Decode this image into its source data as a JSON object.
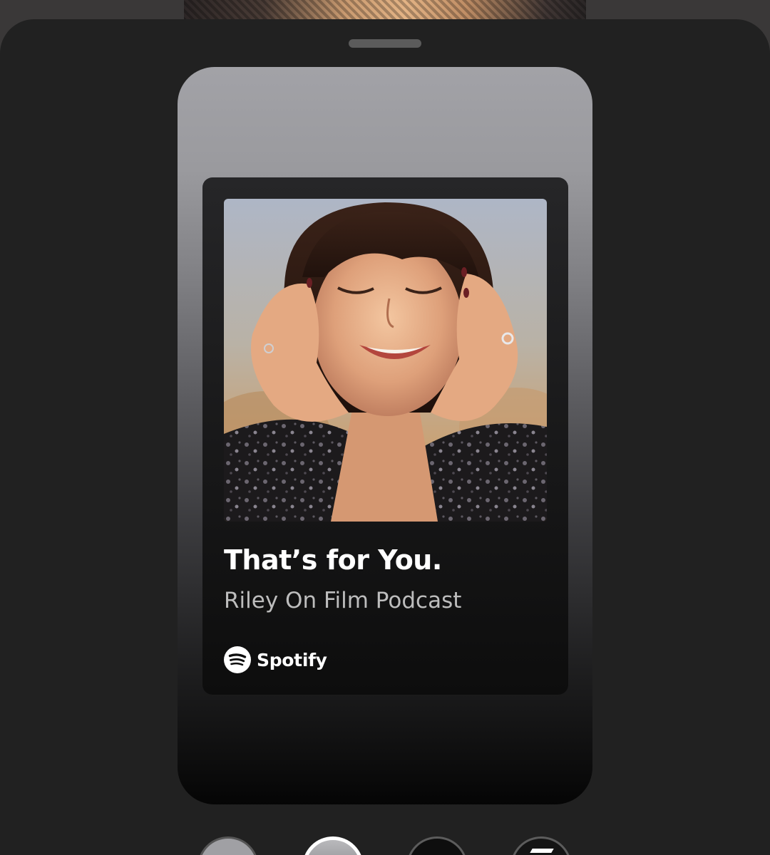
{
  "share_card": {
    "episode_title": "That’s for You.",
    "show_name": "Riley On Film Podcast",
    "brand_name": "Spotify"
  },
  "background_swatches": [
    {
      "label": "gray-gradient",
      "color": "#a0a0a4"
    },
    {
      "label": "light-gray-gradient",
      "color": "#b9b9bc",
      "selected": true
    },
    {
      "label": "black",
      "color": "#0e0e0e"
    },
    {
      "label": "image",
      "color": "#141414"
    }
  ],
  "colors": {
    "sheet_background": "#212121",
    "title_text": "#ffffff",
    "subtitle_text": "#bdbdbd"
  }
}
